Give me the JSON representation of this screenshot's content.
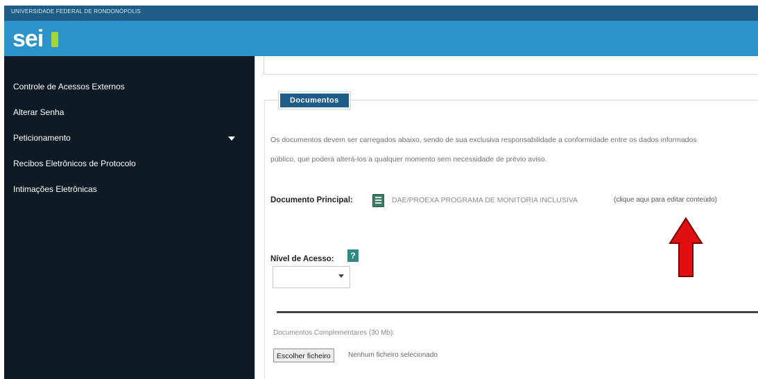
{
  "header": {
    "organization": "UNIVERSIDADE FEDERAL DE RONDONÓPOLIS",
    "logo_text": "sei",
    "colors": {
      "topbar": "#1e5d86",
      "brandbar": "#2a93c9",
      "logo_accent": "#a9d13a"
    }
  },
  "sidebar": {
    "items": [
      {
        "label": "Controle de Acessos Externos"
      },
      {
        "label": "Alterar Senha"
      },
      {
        "label": "Peticionamento",
        "has_submenu": true,
        "icon": "caret-down-icon"
      },
      {
        "label": "Recibos Eletrônicos de Protocolo"
      },
      {
        "label": "Intimações Eletrônicas"
      }
    ],
    "background": "#0e1a24"
  },
  "main": {
    "section_title": "Documentos",
    "intro_line1": "Os documentos devem ser carregados abaixo, sendo de sua exclusiva responsabilidade a conformidade entre os dados informados",
    "intro_line2": "público, que poderá alterá-los a qualquer momento sem necessidade de prévio aviso.",
    "documento_principal": {
      "label": "Documento Principal:",
      "icon": "document-icon",
      "name": "DAE/PROEXA PROGRAMA DE MONITORIA INCLUSIVA",
      "edit_link": "(clique aqui para editar conteúdo)"
    },
    "nivel_acesso": {
      "label": "Nível de Acesso:",
      "help": "?",
      "selected": ""
    },
    "complementares": {
      "label": "Documentos Complementares (30 Mb):",
      "button": "Escolher ficheiro",
      "status": "Nenhum ficheiro selecionado"
    },
    "annotation_arrow_color": "#e01010"
  }
}
